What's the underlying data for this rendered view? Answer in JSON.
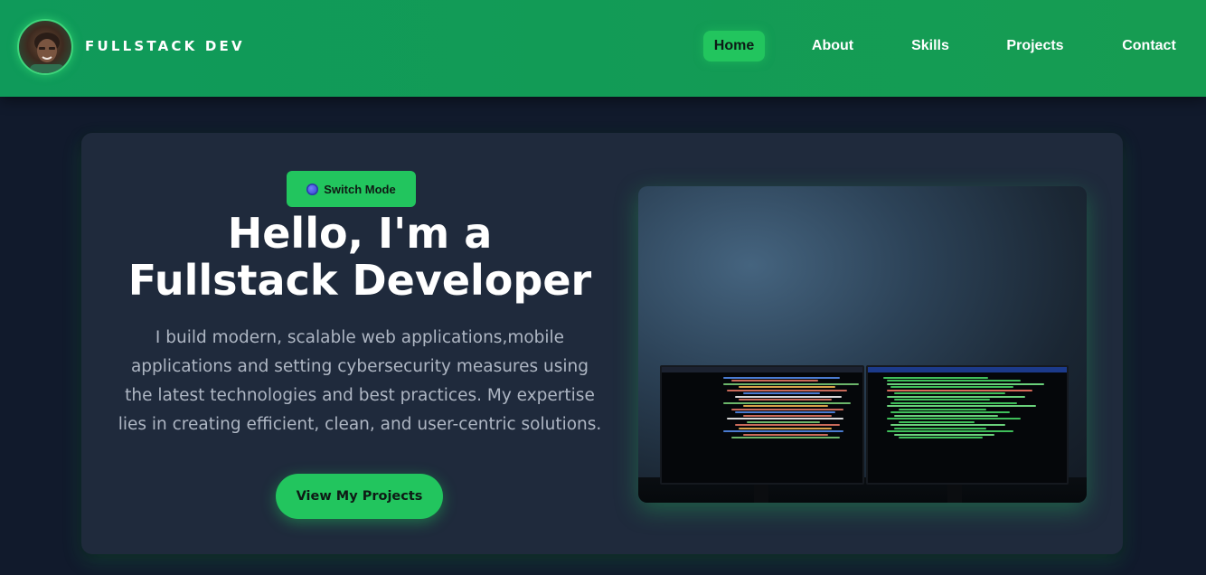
{
  "brand": {
    "name": "FULLSTACK DEV"
  },
  "nav": {
    "items": [
      {
        "label": "Home",
        "active": true
      },
      {
        "label": "About",
        "active": false
      },
      {
        "label": "Skills",
        "active": false
      },
      {
        "label": "Projects",
        "active": false
      },
      {
        "label": "Contact",
        "active": false
      }
    ]
  },
  "hero": {
    "switch_label": "Switch Mode",
    "title_line1": "Hello, I'm a",
    "title_line2": "Fullstack Developer",
    "description": "I build modern, scalable web applications,mobile applications and setting cybersecurity measures using the latest technologies and best practices. My expertise lies in creating efficient, clean, and user-centric solutions.",
    "cta_label": "View My Projects"
  },
  "colors": {
    "nav_bg": "#0f9a5a",
    "accent": "#22c55e",
    "page_bg": "#111a2c",
    "card_bg": "#1f2a3c",
    "text_muted": "#aeb6c3"
  },
  "icons": {
    "switch": "moon-icon"
  }
}
